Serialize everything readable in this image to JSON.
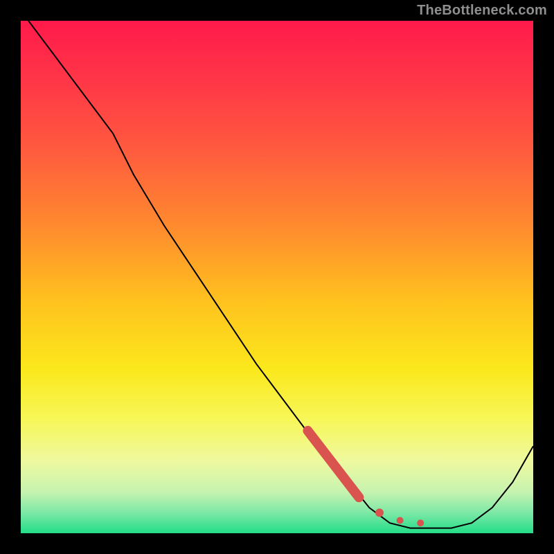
{
  "watermark": "TheBottleneck.com",
  "chart_data": {
    "type": "line",
    "title": "",
    "xlabel": "",
    "ylabel": "",
    "xlim": [
      0,
      100
    ],
    "ylim": [
      0,
      100
    ],
    "grid": false,
    "series": [
      {
        "name": "bottleneck-curve",
        "color": "#000000",
        "x": [
          0,
          6,
          12,
          18,
          22,
          28,
          34,
          40,
          46,
          52,
          58,
          64,
          68,
          72,
          76,
          80,
          84,
          88,
          92,
          96,
          100
        ],
        "y": [
          102,
          94,
          86,
          78,
          70,
          60,
          51,
          42,
          33,
          25,
          17,
          10,
          5,
          2,
          1,
          1,
          1,
          2,
          5,
          10,
          17
        ]
      }
    ],
    "highlight": {
      "name": "highlighted-segment",
      "color": "#d9544f",
      "points": [
        {
          "x": 56,
          "y": 20
        },
        {
          "x": 66,
          "y": 7
        },
        {
          "x": 70,
          "y": 4
        },
        {
          "x": 74,
          "y": 2.5
        },
        {
          "x": 78,
          "y": 2
        }
      ]
    },
    "background_gradient": {
      "type": "vertical",
      "stops": [
        {
          "pos": 0.0,
          "color": "#ff1a4b"
        },
        {
          "pos": 0.12,
          "color": "#ff3747"
        },
        {
          "pos": 0.25,
          "color": "#ff5a3f"
        },
        {
          "pos": 0.4,
          "color": "#ff8a2e"
        },
        {
          "pos": 0.55,
          "color": "#ffc31e"
        },
        {
          "pos": 0.68,
          "color": "#fbe81c"
        },
        {
          "pos": 0.78,
          "color": "#f7f75a"
        },
        {
          "pos": 0.86,
          "color": "#eef9a0"
        },
        {
          "pos": 0.92,
          "color": "#c6f3b0"
        },
        {
          "pos": 0.96,
          "color": "#7de8a6"
        },
        {
          "pos": 1.0,
          "color": "#22dd88"
        }
      ]
    }
  }
}
